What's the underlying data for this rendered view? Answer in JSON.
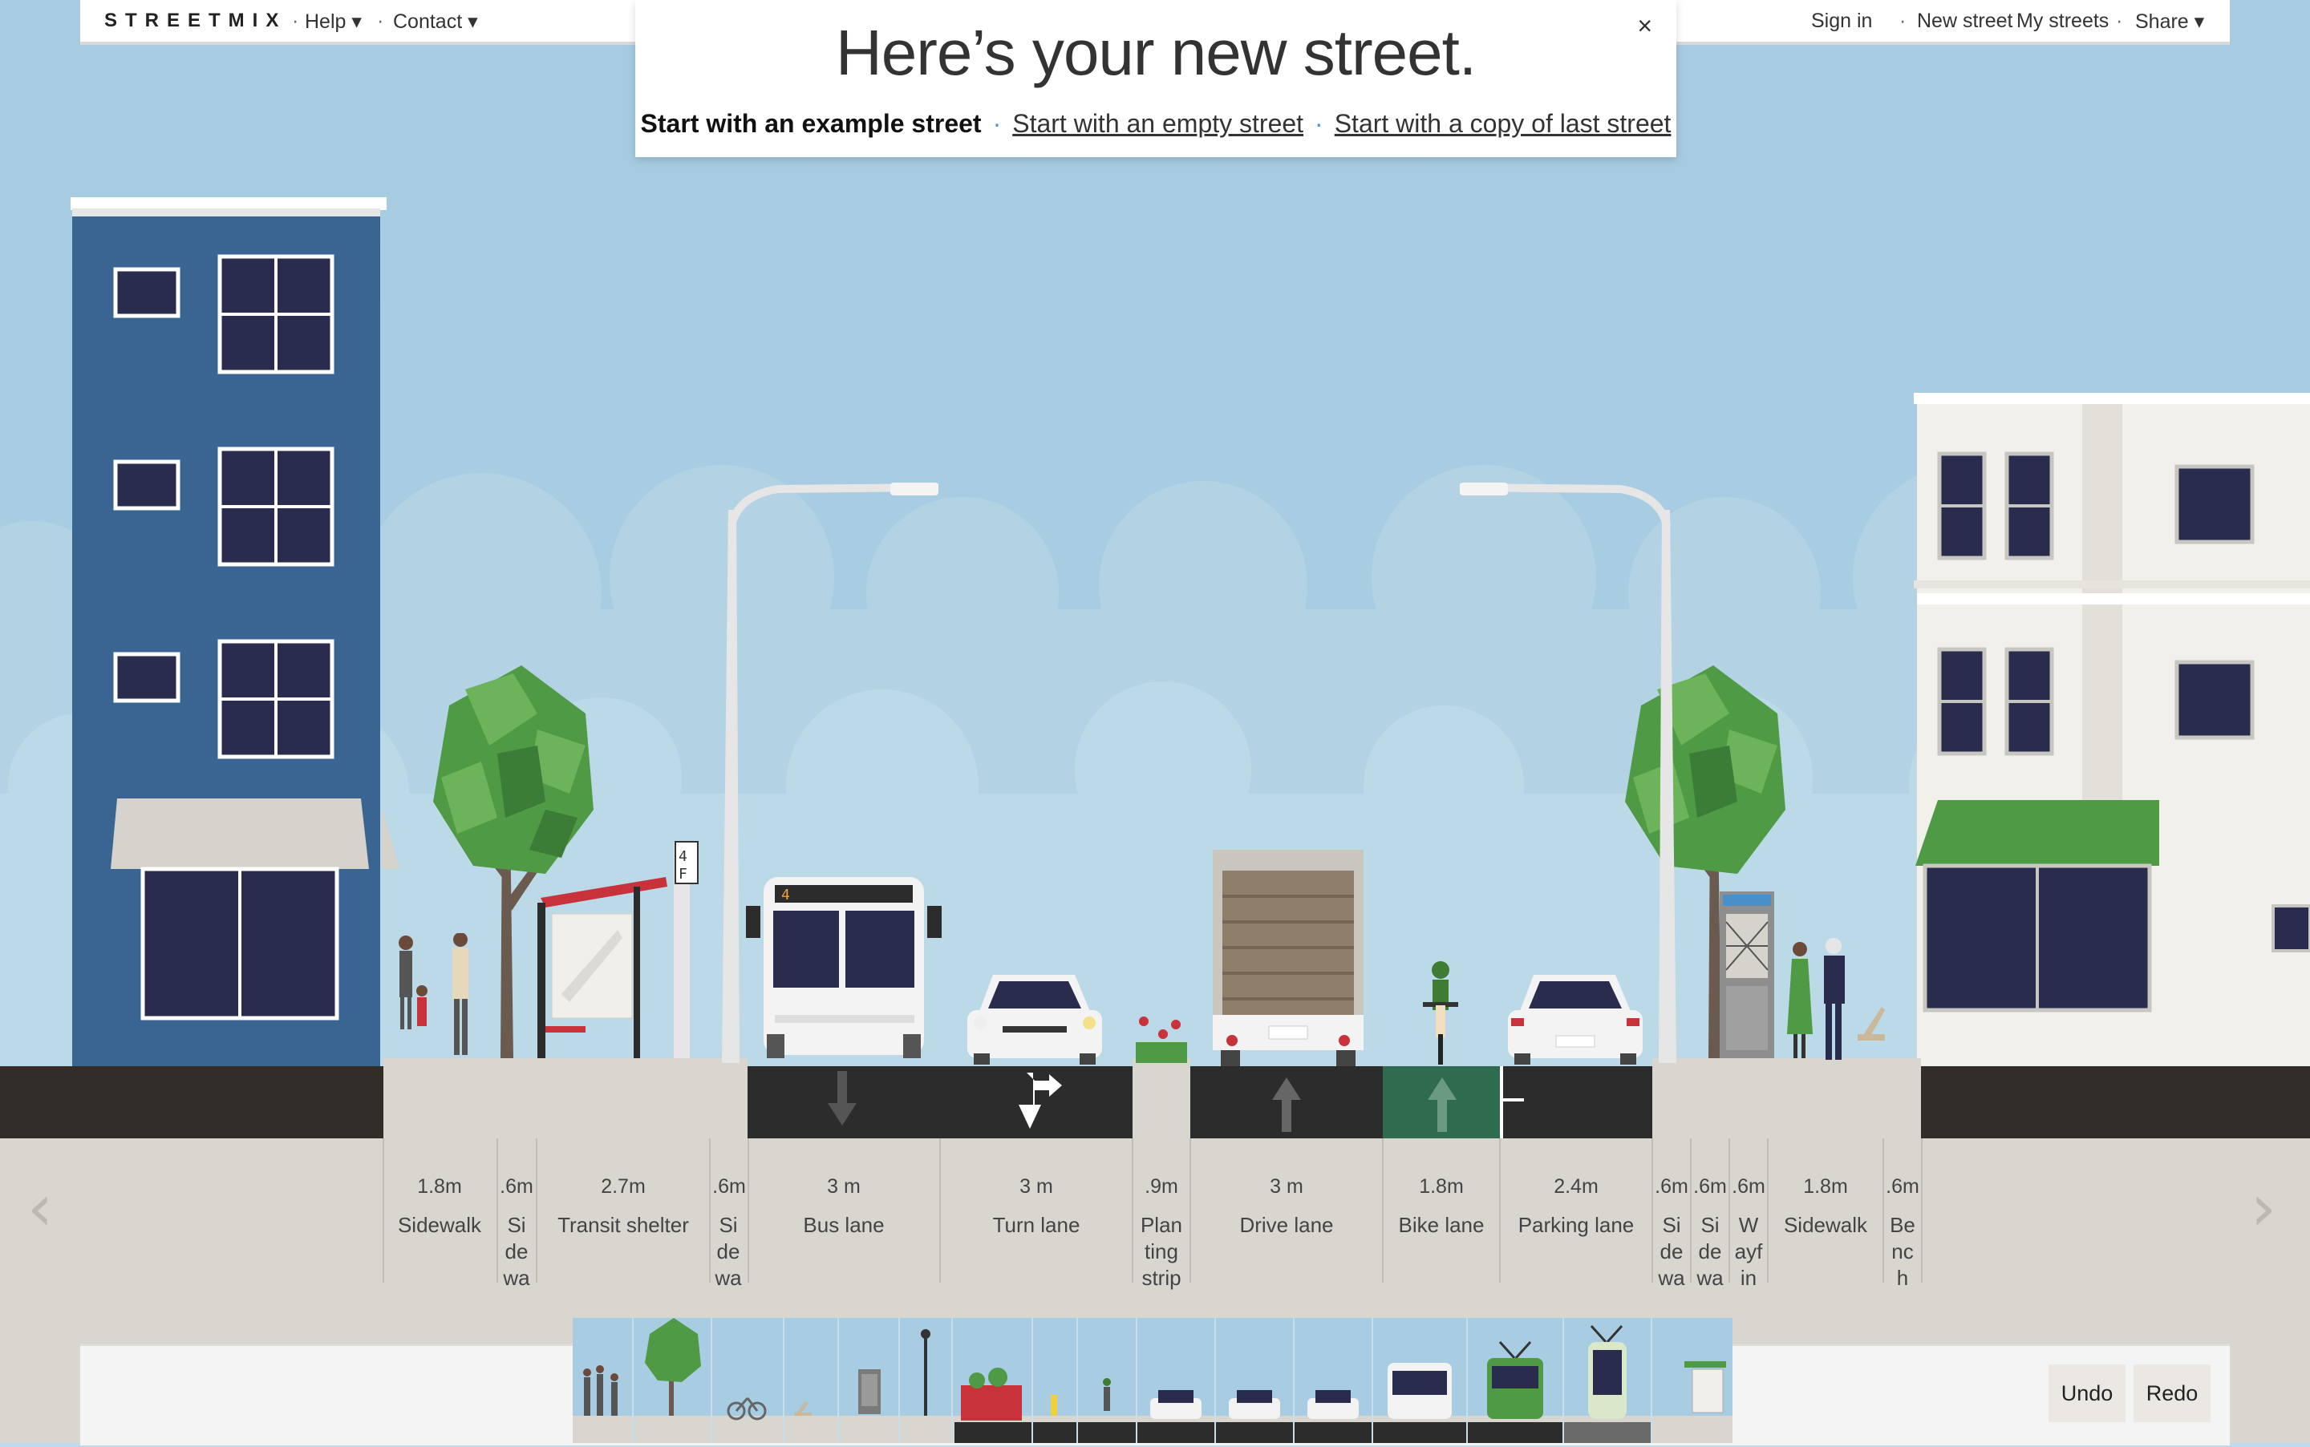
{
  "topbar": {
    "logo": "STREETMIX",
    "help": "Help ▾",
    "contact": "Contact ▾",
    "sign_in": "Sign in",
    "new_street": "New street",
    "my_streets": "My streets",
    "share": "Share ▾",
    "dot": "·"
  },
  "dialog": {
    "title": "Here’s your new street.",
    "close": "×",
    "option_example": "Start with an example street",
    "option_empty": "Start with an empty street",
    "option_copy": "Start with a copy of last street",
    "separator": "·"
  },
  "segments": [
    {
      "width": "1.8m",
      "label": "Sidewalk"
    },
    {
      "width": ".6m",
      "label": "Si de wa"
    },
    {
      "width": "2.7m",
      "label": "Transit shelter"
    },
    {
      "width": ".6m",
      "label": "Si de wa"
    },
    {
      "width": "3 m",
      "label": "Bus lane"
    },
    {
      "width": "3 m",
      "label": "Turn lane"
    },
    {
      "width": ".9m",
      "label": "Plan ting strip"
    },
    {
      "width": "3 m",
      "label": "Drive lane"
    },
    {
      "width": "1.8m",
      "label": "Bike lane"
    },
    {
      "width": "2.4m",
      "label": "Parking lane"
    },
    {
      "width": ".6m",
      "label": "Si de wa"
    },
    {
      "width": ".6m",
      "label": "Si de wa"
    },
    {
      "width": ".6m",
      "label": "W ayf in"
    },
    {
      "width": "1.8m",
      "label": "Sidewalk"
    },
    {
      "width": ".6m",
      "label": "Be nc h"
    }
  ],
  "controls": {
    "undo": "Undo",
    "redo": "Redo",
    "prev": "‹",
    "next": "›"
  },
  "bus_number": "4",
  "colors": {
    "sky": "#a8cde2",
    "road": "#2b2c2b",
    "bike_lane": "#2f6b4f",
    "sidewalk": "#d9d5cf",
    "building_left": "#3a6592",
    "building_right": "#f2f0ea",
    "awning_green": "#4f9a45"
  }
}
